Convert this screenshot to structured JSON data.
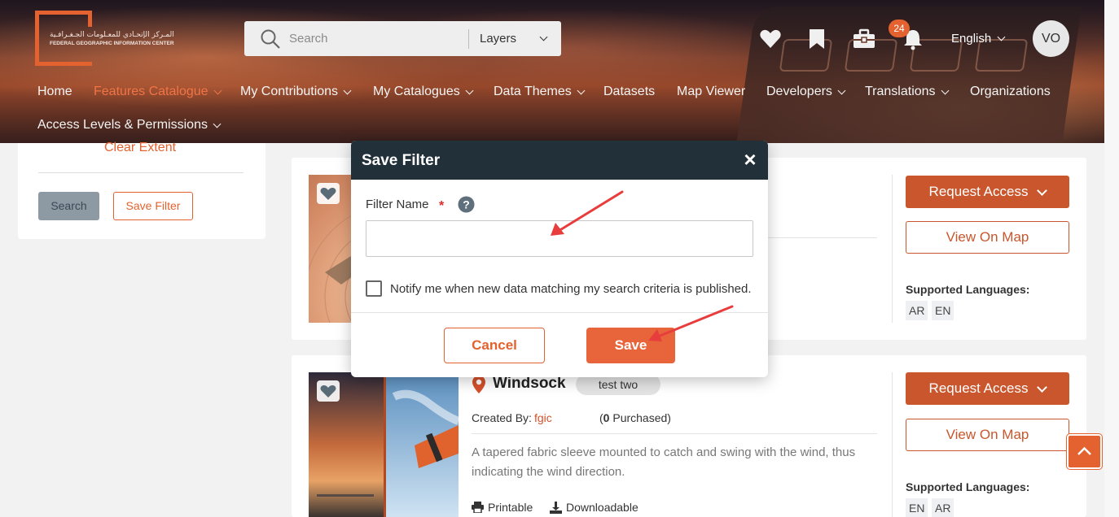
{
  "brand": {
    "logo_ar": "المـركز الإتحـادي للمعـلومات الجـغـرافـية",
    "logo_en": "FEDERAL GEOGRAPHIC INFORMATION CENTER",
    "accent": "#e3622f"
  },
  "search": {
    "placeholder": "Search",
    "layers_label": "Layers"
  },
  "header": {
    "icons": [
      "heart-icon",
      "bookmark-icon",
      "toolbox-icon",
      "bell-icon"
    ],
    "notification_count": "24",
    "language": "English",
    "avatar_initials": "VO"
  },
  "nav": [
    {
      "label": "Home"
    },
    {
      "label": "Features Catalogue",
      "active": true
    },
    {
      "label": "My Contributions"
    },
    {
      "label": "My Catalogues"
    },
    {
      "label": "Data Themes"
    },
    {
      "label": "Datasets"
    },
    {
      "label": "Map Viewer"
    },
    {
      "label": "Developers"
    },
    {
      "label": "Translations"
    },
    {
      "label": "Organizations"
    },
    {
      "label": "Access Levels & Permissions"
    }
  ],
  "sidebar": {
    "clear_extent": "Clear Extent",
    "search_button": "Search",
    "save_filter_button": "Save Filter"
  },
  "cards": [
    {
      "request_access": "Request Access",
      "view_on_map": "View On Map",
      "supported_languages_label": "Supported Languages:",
      "languages": [
        "AR",
        "EN"
      ]
    },
    {
      "title": "Windsock",
      "tag": "test two",
      "created_by_label": "Created By:",
      "created_by": "fgic",
      "purchased": "(0 Purchased)",
      "purchased_count": "0",
      "purchased_label": "Purchased)",
      "description": "A tapered fabric sleeve mounted to catch and swing with the wind, thus indicating the wind direction.",
      "features": [
        "Printable",
        "Downloadable"
      ],
      "request_access": "Request Access",
      "view_on_map": "View On Map",
      "supported_languages_label": "Supported Languages:",
      "languages": [
        "EN",
        "AR"
      ]
    }
  ],
  "modal": {
    "title": "Save Filter",
    "close_symbol": "×",
    "field_label": "Filter Name",
    "required_mark": "*",
    "input_value": "",
    "notify_label": "Notify me when new data matching my search criteria is published.",
    "notify_checked": false,
    "cancel_label": "Cancel",
    "save_label": "Save"
  }
}
